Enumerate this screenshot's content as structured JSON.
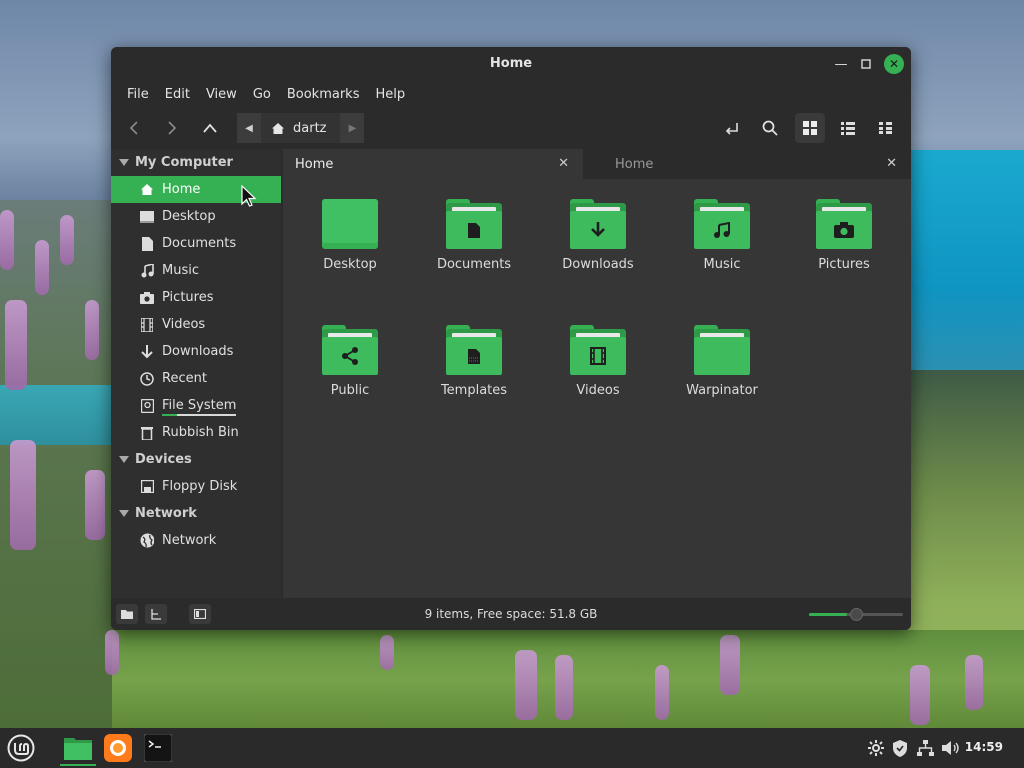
{
  "window": {
    "title": "Home"
  },
  "menu": [
    "File",
    "Edit",
    "View",
    "Go",
    "Bookmarks",
    "Help"
  ],
  "path": {
    "crumb": "dartz"
  },
  "sidebar": {
    "sections": [
      {
        "title": "My Computer",
        "items": [
          "Home",
          "Desktop",
          "Documents",
          "Music",
          "Pictures",
          "Videos",
          "Downloads",
          "Recent",
          "File System",
          "Rubbish Bin"
        ]
      },
      {
        "title": "Devices",
        "items": [
          "Floppy Disk"
        ]
      },
      {
        "title": "Network",
        "items": [
          "Network"
        ]
      }
    ],
    "active": "Home"
  },
  "tabs": [
    {
      "label": "Home"
    },
    {
      "label": "Home"
    }
  ],
  "files": [
    {
      "name": "Desktop",
      "icon": "desktop-folder-icon"
    },
    {
      "name": "Documents",
      "icon": "documents-folder-icon"
    },
    {
      "name": "Downloads",
      "icon": "downloads-folder-icon"
    },
    {
      "name": "Music",
      "icon": "music-folder-icon"
    },
    {
      "name": "Pictures",
      "icon": "pictures-folder-icon"
    },
    {
      "name": "Public",
      "icon": "public-folder-icon"
    },
    {
      "name": "Templates",
      "icon": "templates-folder-icon"
    },
    {
      "name": "Videos",
      "icon": "videos-folder-icon"
    },
    {
      "name": "Warpinator",
      "icon": "folder-icon"
    }
  ],
  "status": {
    "text": "9 items, Free space: 51.8 GB",
    "zoom_level": 0.5
  },
  "panel": {
    "clock": "14:59"
  },
  "colors": {
    "accent": "#35b153",
    "window_bg": "#2b2b2b",
    "content_bg": "#363636"
  }
}
